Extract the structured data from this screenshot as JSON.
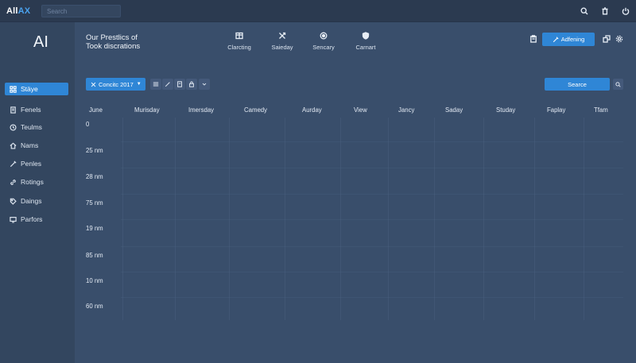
{
  "app": {
    "logo_main": "All",
    "logo_accent": "AX",
    "brand": "AI"
  },
  "search": {
    "placeholder": "Search"
  },
  "topbar": {
    "icons": [
      "search-icon",
      "trash-icon",
      "power-icon"
    ]
  },
  "sidebar": {
    "items": [
      {
        "label": "Stäye",
        "icon": "grid-icon",
        "active": true
      },
      {
        "label": "Fenels",
        "icon": "document-icon",
        "active": false
      },
      {
        "label": "Teulms",
        "icon": "clock-icon",
        "active": false
      },
      {
        "label": "Nams",
        "icon": "home-icon",
        "active": false
      },
      {
        "label": "Penles",
        "icon": "pen-icon",
        "active": false
      },
      {
        "label": "Rotings",
        "icon": "link-icon",
        "active": false
      },
      {
        "label": "Daings",
        "icon": "tag-icon",
        "active": false
      },
      {
        "label": "Parfors",
        "icon": "monitor-icon",
        "active": false
      }
    ]
  },
  "header": {
    "title_line1": "Our Prestlics of",
    "title_line2": "Took discrations",
    "tools": [
      {
        "label": "Clarcting",
        "icon": "table-icon"
      },
      {
        "label": "Saieday",
        "icon": "shuffle-icon"
      },
      {
        "label": "Sencary",
        "icon": "circle-icon"
      },
      {
        "label": "Carnart",
        "icon": "shield-icon"
      }
    ],
    "primary_button": "Adfening"
  },
  "toolbar": {
    "select_value": "Concitc 2017",
    "search_button": "Searce"
  },
  "grid": {
    "columns": [
      "June",
      "Murisday",
      "Imersday",
      "Camedy",
      "Aurday",
      "View",
      "Jancy",
      "Saday",
      "Studay",
      "Faplay",
      "Tfam"
    ],
    "rows": [
      "0",
      "25 nm",
      "28 nm",
      "75 nm",
      "19 nm",
      "85 nm",
      "10 nm",
      "60 nm"
    ]
  },
  "colors": {
    "accent": "#2f86d6",
    "background": "#394e6b",
    "sidebar": "#33465f",
    "topbar": "#2b3a50"
  }
}
